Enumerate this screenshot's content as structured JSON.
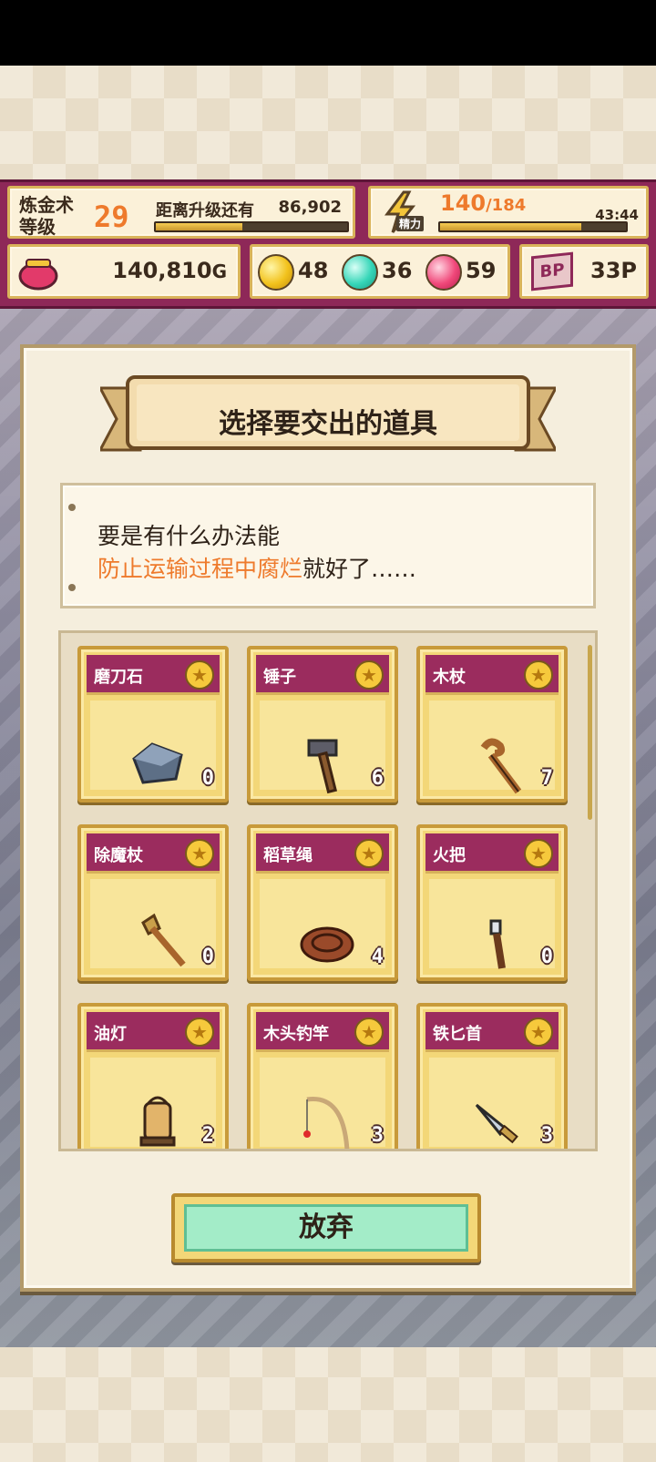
{
  "hud": {
    "level_label": "炼金术\n等级",
    "level": "29",
    "next_label": "距离升级还有",
    "next_value": "86,902",
    "level_progress": 0.45,
    "energy_tag": "精力",
    "energy_current": "140",
    "energy_max": "/184",
    "energy_progress": 0.76,
    "energy_timer": "43:44",
    "gold": "140,810",
    "gold_unit": "G",
    "orb_yellow": "48",
    "orb_teal": "36",
    "orb_pink": "59",
    "bp_icon": "BP",
    "bp_value": "33P",
    "colors": {
      "hud_bg": "#8e2858",
      "accent_orange": "#ee7a2c"
    }
  },
  "dialog": {
    "title": "选择要交出的道具",
    "message_line1": "要是有什么办法能",
    "message_highlight": "防止运输过程中腐烂",
    "message_rest": "就好了……"
  },
  "items": [
    {
      "name": "磨刀石",
      "count": "0",
      "icon": "whetstone-icon"
    },
    {
      "name": "锤子",
      "count": "6",
      "icon": "hammer-icon"
    },
    {
      "name": "木杖",
      "count": "7",
      "icon": "wooden-staff-icon"
    },
    {
      "name": "除魔杖",
      "count": "0",
      "icon": "exorcism-staff-icon"
    },
    {
      "name": "稻草绳",
      "count": "4",
      "icon": "straw-rope-icon"
    },
    {
      "name": "火把",
      "count": "0",
      "icon": "torch-icon"
    },
    {
      "name": "油灯",
      "count": "2",
      "icon": "oil-lamp-icon"
    },
    {
      "name": "木头钓竿",
      "count": "3",
      "icon": "fishing-rod-icon"
    },
    {
      "name": "铁匕首",
      "count": "3",
      "icon": "iron-dagger-icon"
    }
  ],
  "star_glyph": "★",
  "giveup_label": "放弃"
}
